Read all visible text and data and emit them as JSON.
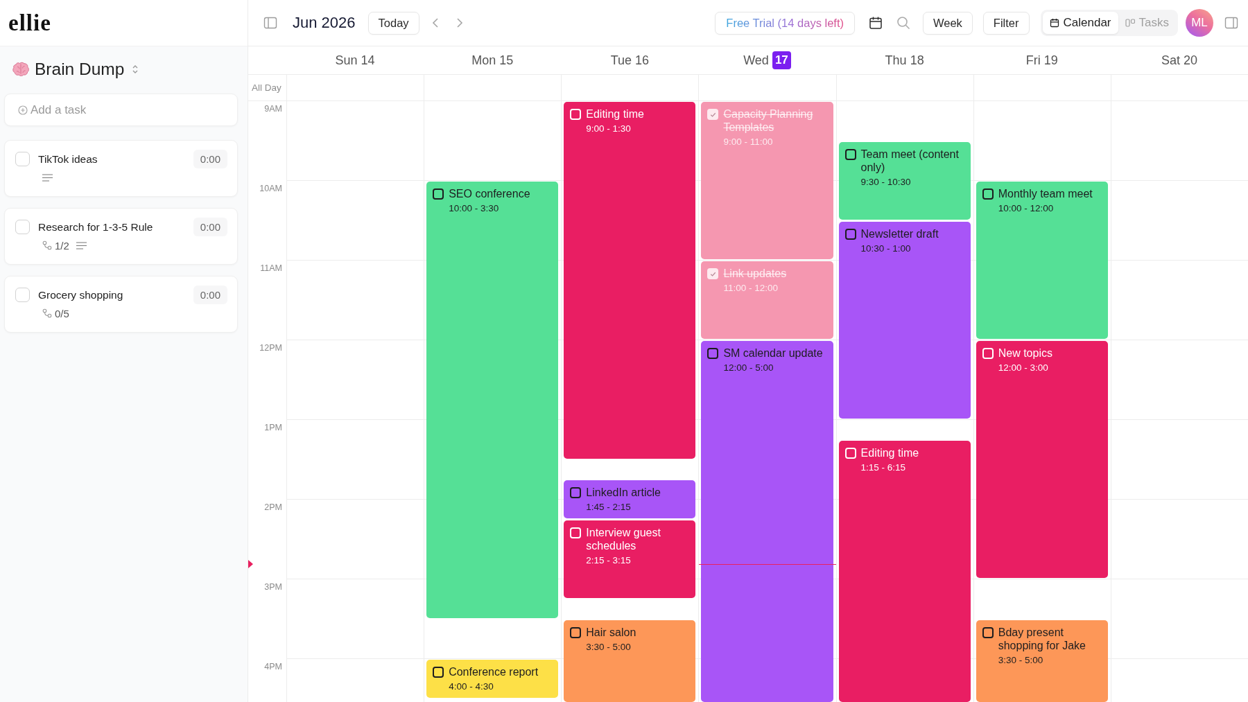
{
  "sidebar": {
    "logo": "ellie",
    "list_title": "Brain Dump",
    "add_task": {
      "placeholder": "Add a task"
    },
    "tasks": [
      {
        "title": "TikTok ideas",
        "checked": false,
        "duration": "0:00",
        "notes": true
      },
      {
        "title": "Research for 1-3-5 Rule",
        "checked": false,
        "duration": "0:00",
        "subtasks": "1/2",
        "notes": true
      },
      {
        "title": "Grocery shopping",
        "checked": false,
        "duration": "0:00",
        "subtasks": "0/5",
        "notes": false
      }
    ]
  },
  "toolbar": {
    "month": "Jun 2026",
    "today_button": "Today",
    "trial_button": "Free Trial (14 days left)",
    "view_select": "Week",
    "filter_button": "Filter",
    "view_tabs": [
      {
        "label": "Calendar",
        "selected": true
      },
      {
        "label": "Tasks",
        "selected": false
      }
    ],
    "avatar": "ML"
  },
  "calendar": {
    "all_day_label": "All Day",
    "hours": [
      "9AM",
      "10AM",
      "11AM",
      "12PM",
      "1PM",
      "2PM",
      "3PM",
      "4PM"
    ],
    "days": [
      {
        "weekday": "Sun",
        "date": "14",
        "today": false
      },
      {
        "weekday": "Mon",
        "date": "15",
        "today": false,
        "events": [
          {
            "title": "SEO conference",
            "time": "10:00 - 3:30",
            "color": "#55e096",
            "done": false
          },
          {
            "title": "Conference report",
            "time": "4:00 - 4:30",
            "color": "#fde047",
            "done": false
          }
        ]
      },
      {
        "weekday": "Tue",
        "date": "16",
        "today": false,
        "events": [
          {
            "title": "Editing time",
            "time": "9:00 - 1:30",
            "color": "#e91e63",
            "done": false
          },
          {
            "title": "LinkedIn article",
            "time": "1:45 - 2:15",
            "color": "#a855f7",
            "done": false
          },
          {
            "title": "Interview guest schedules",
            "time": "2:15 - 3:15",
            "color": "#e91e63",
            "done": false
          },
          {
            "title": "Hair salon",
            "time": "3:30 - 5:00",
            "color": "#fd9758",
            "done": false
          }
        ]
      },
      {
        "weekday": "Wed",
        "date": "17",
        "today": true,
        "events": [
          {
            "title": "Capacity Planning Templates",
            "time": "9:00 - 11:00",
            "color": "#f597b0",
            "done": true
          },
          {
            "title": "Link updates",
            "time": "11:00 - 12:00",
            "color": "#f597b0",
            "done": true
          },
          {
            "title": "SM calendar update",
            "time": "12:00 - 5:00",
            "color": "#a855f7",
            "done": false
          }
        ]
      },
      {
        "weekday": "Thu",
        "date": "18",
        "today": false,
        "events": [
          {
            "title": "Team meet (content only)",
            "time": "9:30 - 10:30",
            "color": "#55e096",
            "done": false
          },
          {
            "title": "Newsletter draft",
            "time": "10:30 - 1:00",
            "color": "#a855f7",
            "done": false
          },
          {
            "title": "Editing time",
            "time": "1:15 - 6:15",
            "color": "#e91e63",
            "done": false
          }
        ]
      },
      {
        "weekday": "Fri",
        "date": "19",
        "today": false,
        "events": [
          {
            "title": "Monthly team meet",
            "time": "10:00 - 12:00",
            "color": "#55e096",
            "done": false
          },
          {
            "title": "New topics",
            "time": "12:00 - 3:00",
            "color": "#e91e63",
            "done": false
          },
          {
            "title": "Bday present shopping for Jake",
            "time": "3:30 - 5:00",
            "color": "#fd9758",
            "done": false
          }
        ]
      },
      {
        "weekday": "Sat",
        "date": "20",
        "today": false
      }
    ]
  }
}
